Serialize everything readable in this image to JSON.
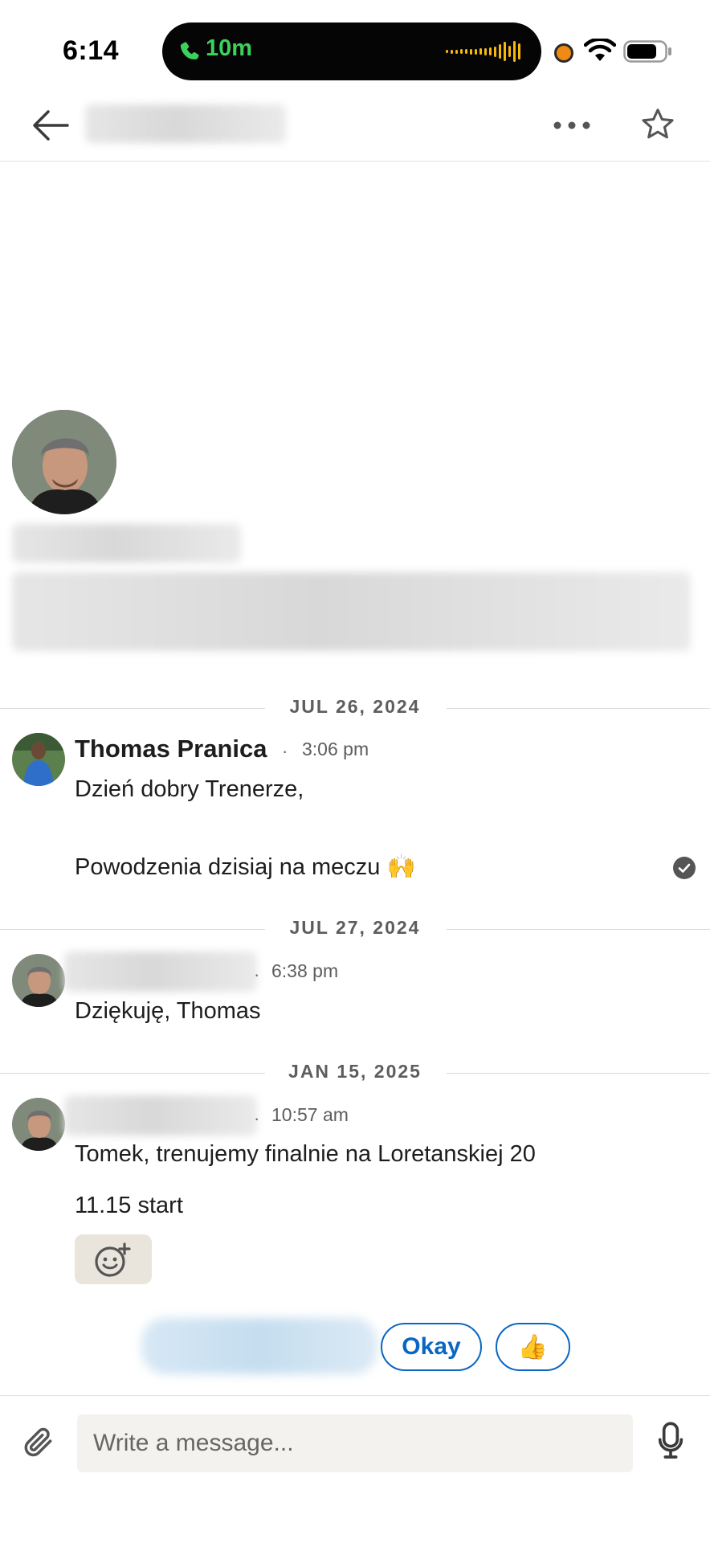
{
  "status_bar": {
    "time": "6:14",
    "call_duration": "10m",
    "call_color": "#3cd15a"
  },
  "header": {
    "back_icon": "arrow-left-icon",
    "more_icon": "more-horizontal-icon",
    "star_icon": "star-outline-icon"
  },
  "thread": [
    {
      "date": "JUL 26, 2024",
      "messages": [
        {
          "sender": "Thomas Pranica",
          "time": "3:06 pm",
          "lines": [
            "Dzień dobry Trenerze,",
            "Powodzenia dzisiaj na meczu 🙌"
          ],
          "status": "seen-check-icon"
        }
      ]
    },
    {
      "date": "JUL 27, 2024",
      "messages": [
        {
          "sender": "",
          "time": "6:38 pm",
          "lines": [
            "Dziękuję, Thomas"
          ]
        }
      ]
    },
    {
      "date": "JAN 15, 2025",
      "messages": [
        {
          "sender": "",
          "time": "10:57 am",
          "lines": [
            "Tomek, trenujemy finalnie na Loretanskiej 20",
            "11.15 start"
          ],
          "reaction_icon": "add-reaction-icon"
        }
      ]
    }
  ],
  "quick_replies": [
    "Okay",
    "👍"
  ],
  "composer": {
    "placeholder": "Write a message...",
    "attach_icon": "paperclip-icon",
    "mic_icon": "microphone-icon"
  },
  "colors": {
    "accent": "#0a66c2",
    "reaction_bg": "#e9e5dc"
  }
}
